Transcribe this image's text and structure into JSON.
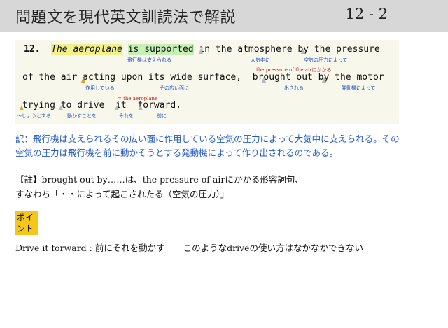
{
  "header": {
    "title": "問題文を現代英文訓読法で解説",
    "page": "12 - 2"
  },
  "sentence": {
    "number": "12.",
    "line1": {
      "w_the_aeroplane": "The aeroplane",
      "w_is_supported": "is supported",
      "w_in_the_atmosphere": "in the atmosphere",
      "w_by_the_pressure": "by the pressure"
    },
    "line2": {
      "w_of_the_air": "of the air",
      "w_acting": "acting upon its wide surface,",
      "w_brought_out": "brought out",
      "w_by_the_motor": "by the motor"
    },
    "line3": {
      "w_trying": "trying",
      "w_to_drive": "to drive",
      "w_it": "it",
      "w_forward": "forward."
    }
  },
  "annotations": {
    "hikouki": "飛行機は支えられる",
    "taikichuu": "大気中に",
    "kuuki_atsuryoku": "空気の圧力によって",
    "sayou": "作用している",
    "hiroi_men": "その広い面に",
    "pressure_ref": "the pressure of the airにかかる",
    "dasareru": "出される",
    "hatsudouki": "発動機によって",
    "shiyou": "〜しようとする",
    "ugokasu": "動かすことを",
    "sore": "それを",
    "mae": "前に",
    "aeroplane_ref": "= the aeroplane"
  },
  "translation": "訳：飛行機は支えられるその広い面に作用している空気の圧力によって大気中に支えられる。その空気の圧力は飛行機を前に動かそうとする発動機によって作り出されるのである。",
  "note": {
    "line1": "【註】brought out by……は、the pressure of airにかかる形容詞句、",
    "line2": "すなわち「・・によって起こされたる（空気の圧力）」"
  },
  "point": {
    "label": "ポイント"
  },
  "drive": {
    "phrase": "Drive it forward : 前にそれを動かす",
    "comment": "このようなdriveの使い方はなかなかできない"
  },
  "colors": {
    "annotation_blue": "#2150c8",
    "reference_red": "#c82020",
    "highlight_yellow": "#f1f18a",
    "highlight_green": "#c8f0b6",
    "point_badge": "#f5c61c"
  }
}
